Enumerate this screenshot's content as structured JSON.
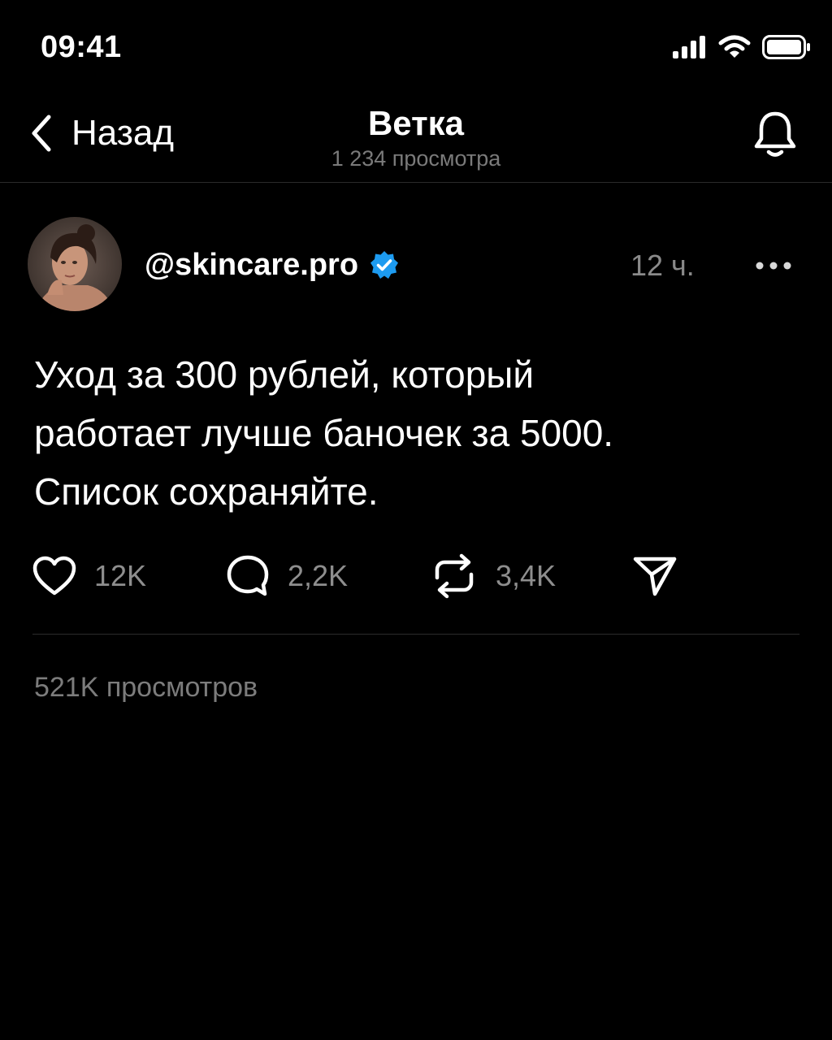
{
  "status_bar": {
    "time": "09:41"
  },
  "nav": {
    "back_label": "Назад",
    "title": "Ветка",
    "subtitle": "1 234 просмотра"
  },
  "post": {
    "username": "@skincare.pro",
    "verified": true,
    "time": "12 ч.",
    "text": "Уход за 300 рублей, который\nработает лучше баночек за 5000.\nСписок сохраняйте.",
    "actions": {
      "likes": "12K",
      "comments": "2,2K",
      "reposts": "3,4K"
    },
    "views": "521K просмотров"
  },
  "colors": {
    "background": "#000000",
    "text_primary": "#ffffff",
    "text_secondary": "#8a8a8a",
    "verified_badge": "#1d9bf0",
    "divider": "#2c2c2c"
  },
  "icons": {
    "back": "chevron-left-icon",
    "notifications": "bell-icon",
    "more": "more-horizontal-icon",
    "like": "heart-icon",
    "comment": "comment-icon",
    "repost": "repost-icon",
    "share": "send-icon",
    "verified": "verified-badge-icon"
  }
}
